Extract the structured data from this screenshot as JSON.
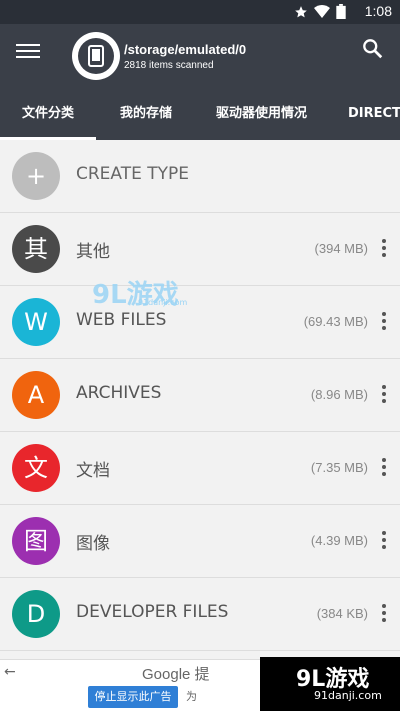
{
  "status": {
    "time": "1:08"
  },
  "appbar": {
    "path": "/storage/emulated/0",
    "scanned": "2818 items scanned"
  },
  "tabs": [
    {
      "label": "文件分类"
    },
    {
      "label": "我的存储"
    },
    {
      "label": "驱动器使用情况"
    },
    {
      "label": "DIRECTOR"
    }
  ],
  "create": {
    "symbol": "+",
    "label": "CREATE TYPE"
  },
  "rows": [
    {
      "symbol": "其",
      "label": "其他",
      "size": "(394 MB)",
      "color": "#4a4a4a"
    },
    {
      "symbol": "W",
      "label": "WEB FILES",
      "size": "(69.43 MB)",
      "color": "#1ab5d6"
    },
    {
      "symbol": "A",
      "label": "ARCHIVES",
      "size": "(8.96 MB)",
      "color": "#f0640e"
    },
    {
      "symbol": "文",
      "label": "文档",
      "size": "(7.35 MB)",
      "color": "#e8262c"
    },
    {
      "symbol": "图",
      "label": "图像",
      "size": "(4.39 MB)",
      "color": "#9c2fb0"
    },
    {
      "symbol": "D",
      "label": "DEVELOPER FILES",
      "size": "(384 KB)",
      "color": "#0e9a88"
    }
  ],
  "ad": {
    "google": "Google 提",
    "stop": "停止显示此广告",
    "why": "为"
  },
  "watermark": {
    "logo": "9L游戏",
    "small": "91danji.com"
  },
  "brand": {
    "title": "9L游戏",
    "url": "91danji.com"
  }
}
